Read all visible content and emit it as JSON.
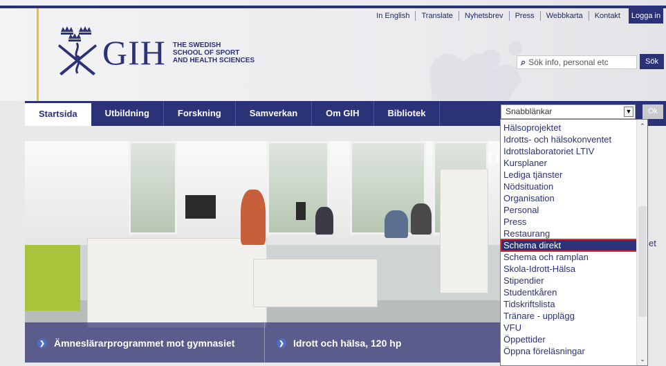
{
  "colors": {
    "brand": "#2b3278",
    "accent_gold": "#e8c233",
    "selection_border": "#e0282e"
  },
  "top_links": [
    "In English",
    "Translate",
    "Nyhetsbrev",
    "Press",
    "Webbkarta",
    "Kontakt"
  ],
  "login_label": "Logga in",
  "logo": {
    "name": "GIH",
    "line1": "THE SWEDISH",
    "line2": "SCHOOL OF SPORT",
    "line3": "AND HEALTH SCIENCES"
  },
  "search": {
    "placeholder": "Sök info, personal etc",
    "button": "Sök",
    "icon": "search-icon"
  },
  "nav": [
    "Startsida",
    "Utbildning",
    "Forskning",
    "Samverkan",
    "Om GIH",
    "Bibliotek"
  ],
  "quicklinks": {
    "selected": "Snabblänkar",
    "ok_label": "Ok",
    "items": [
      "Hälsoprojektet",
      "Idrotts- och hälsokonventet",
      "Idrottslaboratoriet LTIV",
      "Kursplaner",
      "Lediga tjänster",
      "Nödsituation",
      "Organisation",
      "Personal",
      "Press",
      "Restaurang",
      "Schema direkt",
      "Schema och ramplan",
      "Skola-Idrott-Hälsa",
      "Stipendier",
      "Studentkåren",
      "Tidskriftslista",
      "Tränare - upplägg",
      "VFU",
      "Öppettider",
      "Öppna föreläsningar"
    ],
    "highlighted_index": 10
  },
  "hero": {
    "captions": [
      "Ämneslärarprogrammet mot gymnasiet",
      "Idrott och hälsa, 120 hp"
    ],
    "pause_icon": "pause-icon"
  },
  "side_fragment": "et"
}
